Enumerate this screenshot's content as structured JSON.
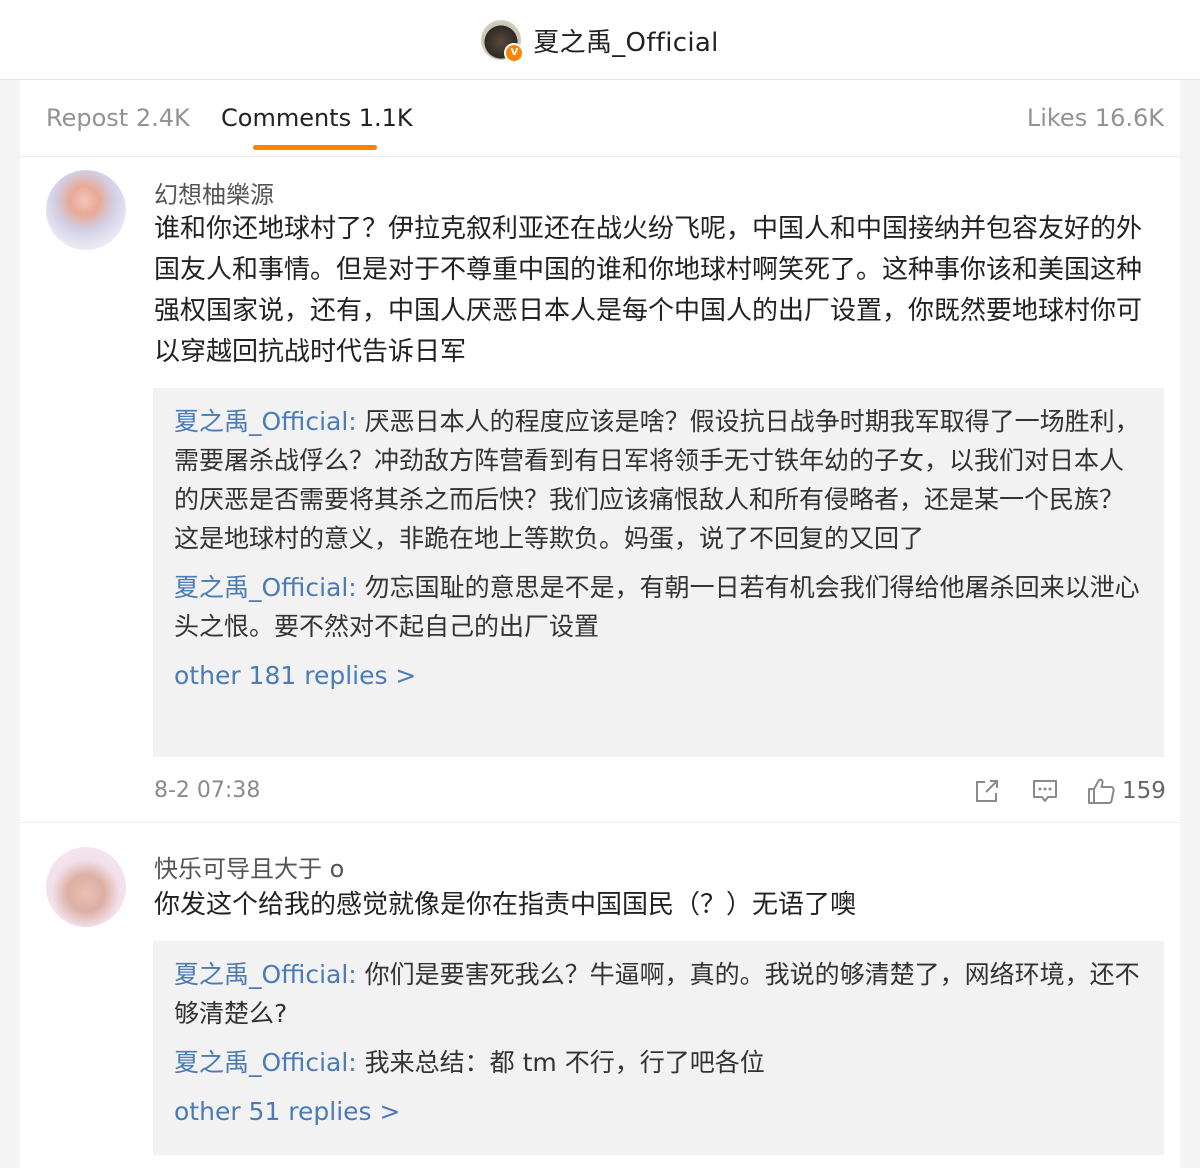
{
  "header": {
    "title": "夏之禹_Official",
    "verified_badge": "V"
  },
  "tabs": {
    "repost": "Repost 2.4K",
    "comments": "Comments 1.1K",
    "likes": "Likes 16.6K",
    "active": "comments",
    "accent_color": "#ff8200"
  },
  "comments": [
    {
      "username": "幻想柚樂源",
      "text": "谁和你还地球村了？伊拉克叙利亚还在战火纷飞呢，中国人和中国接纳并包容友好的外国友人和事情。但是对于不尊重中国的谁和你地球村啊笑死了。这种事你该和美国这种强权国家说，还有，中国人厌恶日本人是每个中国人的出厂设置，你既然要地球村你可以穿越回抗战时代告诉日军",
      "replies": [
        {
          "author": "夏之禹_Official:",
          "text": " 厌恶日本人的程度应该是啥？假设抗日战争时期我军取得了一场胜利，需要屠杀战俘么？冲劲敌方阵营看到有日军将领手无寸铁年幼的子女，以我们对日本人的厌恶是否需要将其杀之而后快？我们应该痛恨敌人和所有侵略者，还是某一个民族？这是地球村的意义，非跪在地上等欺负。妈蛋，说了不回复的又回了"
        },
        {
          "author": "夏之禹_Official:",
          "text": " 勿忘国耻的意思是不是，有朝一日若有机会我们得给他屠杀回来以泄心头之恨。要不然对不起自己的出厂设置"
        }
      ],
      "more_replies": "other 181 replies >",
      "time": "8-2 07:38",
      "likes": "159"
    },
    {
      "username": "快乐可导且大于 o",
      "text": "你发这个给我的感觉就像是你在指责中国国民（？）无语了噢",
      "replies": [
        {
          "author": "夏之禹_Official:",
          "text": " 你们是要害死我么？牛逼啊，真的。我说的够清楚了，网络环境，还不够清楚么?"
        },
        {
          "author": "夏之禹_Official:",
          "text": " 我来总结：都 tm 不行，行了吧各位"
        }
      ],
      "more_replies": "other 51 replies >"
    }
  ],
  "icons": [
    "share-icon",
    "comment-icon",
    "like-icon"
  ],
  "colors": {
    "link": "#4a7bb7",
    "reply_bg": "#f2f2f2",
    "muted": "#8a8a8a"
  }
}
